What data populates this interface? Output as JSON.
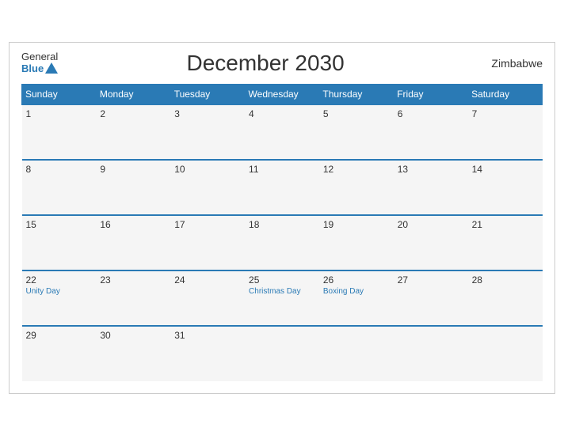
{
  "header": {
    "logo_general": "General",
    "logo_blue": "Blue",
    "title": "December 2030",
    "country": "Zimbabwe"
  },
  "days_of_week": [
    "Sunday",
    "Monday",
    "Tuesday",
    "Wednesday",
    "Thursday",
    "Friday",
    "Saturday"
  ],
  "weeks": [
    [
      {
        "day": "1",
        "holiday": ""
      },
      {
        "day": "2",
        "holiday": ""
      },
      {
        "day": "3",
        "holiday": ""
      },
      {
        "day": "4",
        "holiday": ""
      },
      {
        "day": "5",
        "holiday": ""
      },
      {
        "day": "6",
        "holiday": ""
      },
      {
        "day": "7",
        "holiday": ""
      }
    ],
    [
      {
        "day": "8",
        "holiday": ""
      },
      {
        "day": "9",
        "holiday": ""
      },
      {
        "day": "10",
        "holiday": ""
      },
      {
        "day": "11",
        "holiday": ""
      },
      {
        "day": "12",
        "holiday": ""
      },
      {
        "day": "13",
        "holiday": ""
      },
      {
        "day": "14",
        "holiday": ""
      }
    ],
    [
      {
        "day": "15",
        "holiday": ""
      },
      {
        "day": "16",
        "holiday": ""
      },
      {
        "day": "17",
        "holiday": ""
      },
      {
        "day": "18",
        "holiday": ""
      },
      {
        "day": "19",
        "holiday": ""
      },
      {
        "day": "20",
        "holiday": ""
      },
      {
        "day": "21",
        "holiday": ""
      }
    ],
    [
      {
        "day": "22",
        "holiday": "Unity Day"
      },
      {
        "day": "23",
        "holiday": ""
      },
      {
        "day": "24",
        "holiday": ""
      },
      {
        "day": "25",
        "holiday": "Christmas Day"
      },
      {
        "day": "26",
        "holiday": "Boxing Day"
      },
      {
        "day": "27",
        "holiday": ""
      },
      {
        "day": "28",
        "holiday": ""
      }
    ],
    [
      {
        "day": "29",
        "holiday": ""
      },
      {
        "day": "30",
        "holiday": ""
      },
      {
        "day": "31",
        "holiday": ""
      },
      {
        "day": "",
        "holiday": ""
      },
      {
        "day": "",
        "holiday": ""
      },
      {
        "day": "",
        "holiday": ""
      },
      {
        "day": "",
        "holiday": ""
      }
    ]
  ]
}
